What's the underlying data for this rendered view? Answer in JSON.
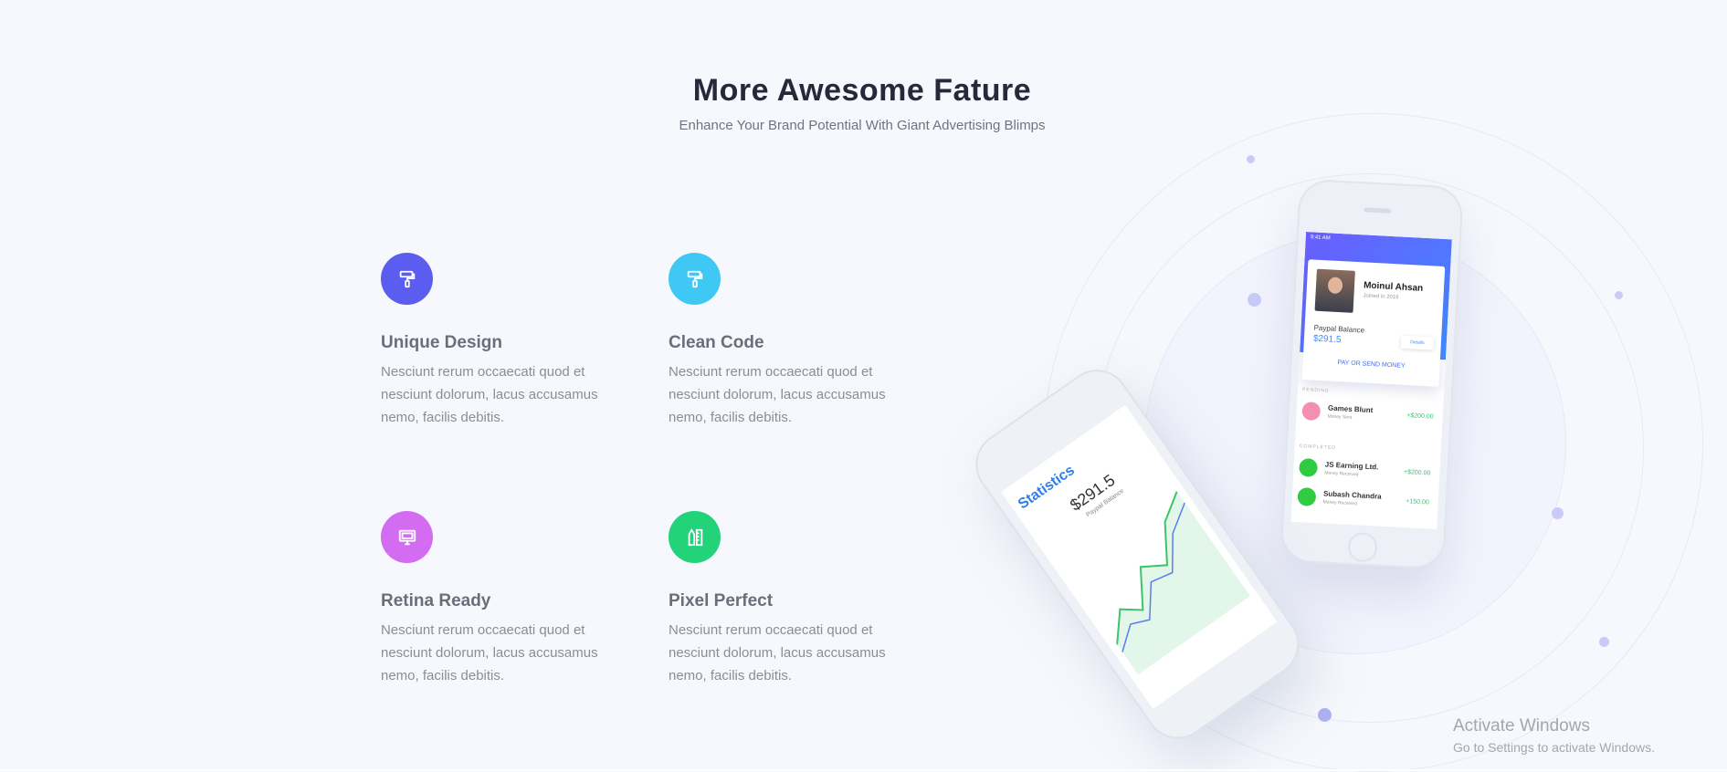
{
  "section": {
    "title": "More Awesome Fature",
    "subtitle": "Enhance Your Brand Potential With Giant Advertising Blimps"
  },
  "features": [
    {
      "title": "Unique Design",
      "text": "Nesciunt rerum occaecati quod et nesciunt dolorum, lacus accusamus nemo, facilis debitis.",
      "icon": "paint-roller-icon",
      "color": "#5b5cf0"
    },
    {
      "title": "Clean Code",
      "text": "Nesciunt rerum occaecati quod et nesciunt dolorum, lacus accusamus nemo, facilis debitis.",
      "icon": "paint-roller-icon",
      "color": "#3fc8f4"
    },
    {
      "title": "Retina Ready",
      "text": "Nesciunt rerum occaecati quod et nesciunt dolorum, lacus accusamus nemo, facilis debitis.",
      "icon": "monitor-icon",
      "color": "#d36cf0"
    },
    {
      "title": "Pixel Perfect",
      "text": "Nesciunt rerum occaecati quod et nesciunt dolorum, lacus accusamus nemo, facilis debitis.",
      "icon": "pencil-ruler-icon",
      "color": "#22d37a"
    }
  ],
  "phone_back": {
    "status": "9:41 AM",
    "name": "Moinul Ahsan",
    "sub": "Joined in 2019",
    "paypal_label": "Paypal Balance",
    "paypal_amount": "$291.5",
    "details": "Details",
    "pay_button": "PAY OR SEND MONEY",
    "pending_label": "PENDING",
    "completed_label": "COMPLETED",
    "transactions": [
      {
        "name": "Games Blunt",
        "sub": "Money Sent",
        "amount": "+$200.00",
        "color": "#f48fb1"
      },
      {
        "name": "JS Earning Ltd.",
        "sub": "Money Received",
        "amount": "+$200.00",
        "color": "#2ecc40"
      },
      {
        "name": "Subash Chandra",
        "sub": "Money Received",
        "amount": "+150.00",
        "color": "#2ecc40"
      }
    ]
  },
  "phone_front": {
    "title": "Statistics",
    "amount": "$291.5",
    "label": "Paypal Balance"
  },
  "watermark": {
    "title": "Activate Windows",
    "subtitle": "Go to Settings to activate Windows."
  }
}
